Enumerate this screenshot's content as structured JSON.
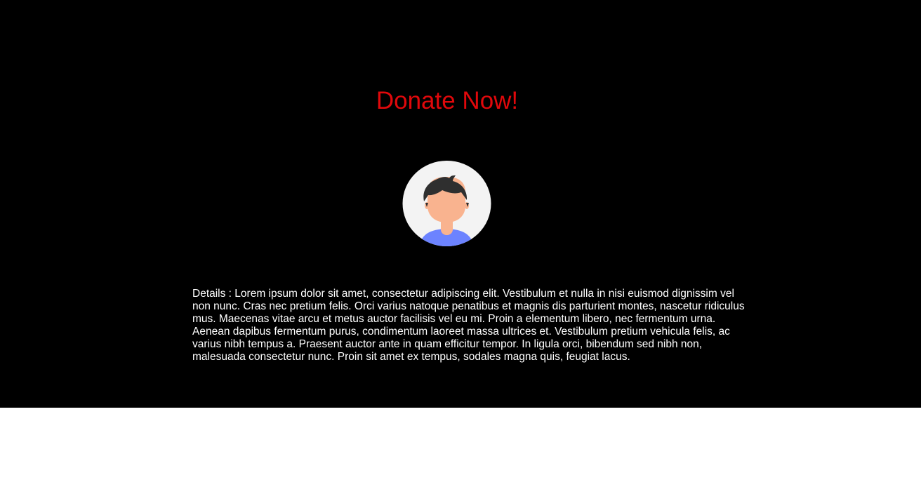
{
  "page": {
    "title": "Donate Now!",
    "details": "Details : Lorem ipsum dolor sit amet, consectetur adipiscing elit. Vestibulum et nulla in nisi euismod dignissim vel non nunc. Cras nec pretium felis. Orci varius natoque penatibus et magnis dis parturient montes, nascetur ridiculus mus. Maecenas vitae arcu et metus auctor facilisis vel eu mi. Proin a elementum libero, nec fermentum urna. Aenean dapibus fermentum purus, condimentum laoreet massa ultrices et. Vestibulum pretium vehicula felis, ac varius nibh tempus a. Praesent auctor ante in quam efficitur tempor. In ligula orci, bibendum sed nibh non, malesuada consectetur nunc. Proin sit amet ex tempus, sodales magna quis, feugiat lacus."
  },
  "avatar": {
    "icon": "user-avatar-icon"
  },
  "colors": {
    "hero_background": "#000000",
    "title": "#e0080b",
    "text": "#ffffff",
    "avatar_background": "#f3f3f3",
    "avatar_skin": "#f9b38f",
    "avatar_hair": "#2f2f2f",
    "avatar_shirt": "#6c83ff"
  }
}
